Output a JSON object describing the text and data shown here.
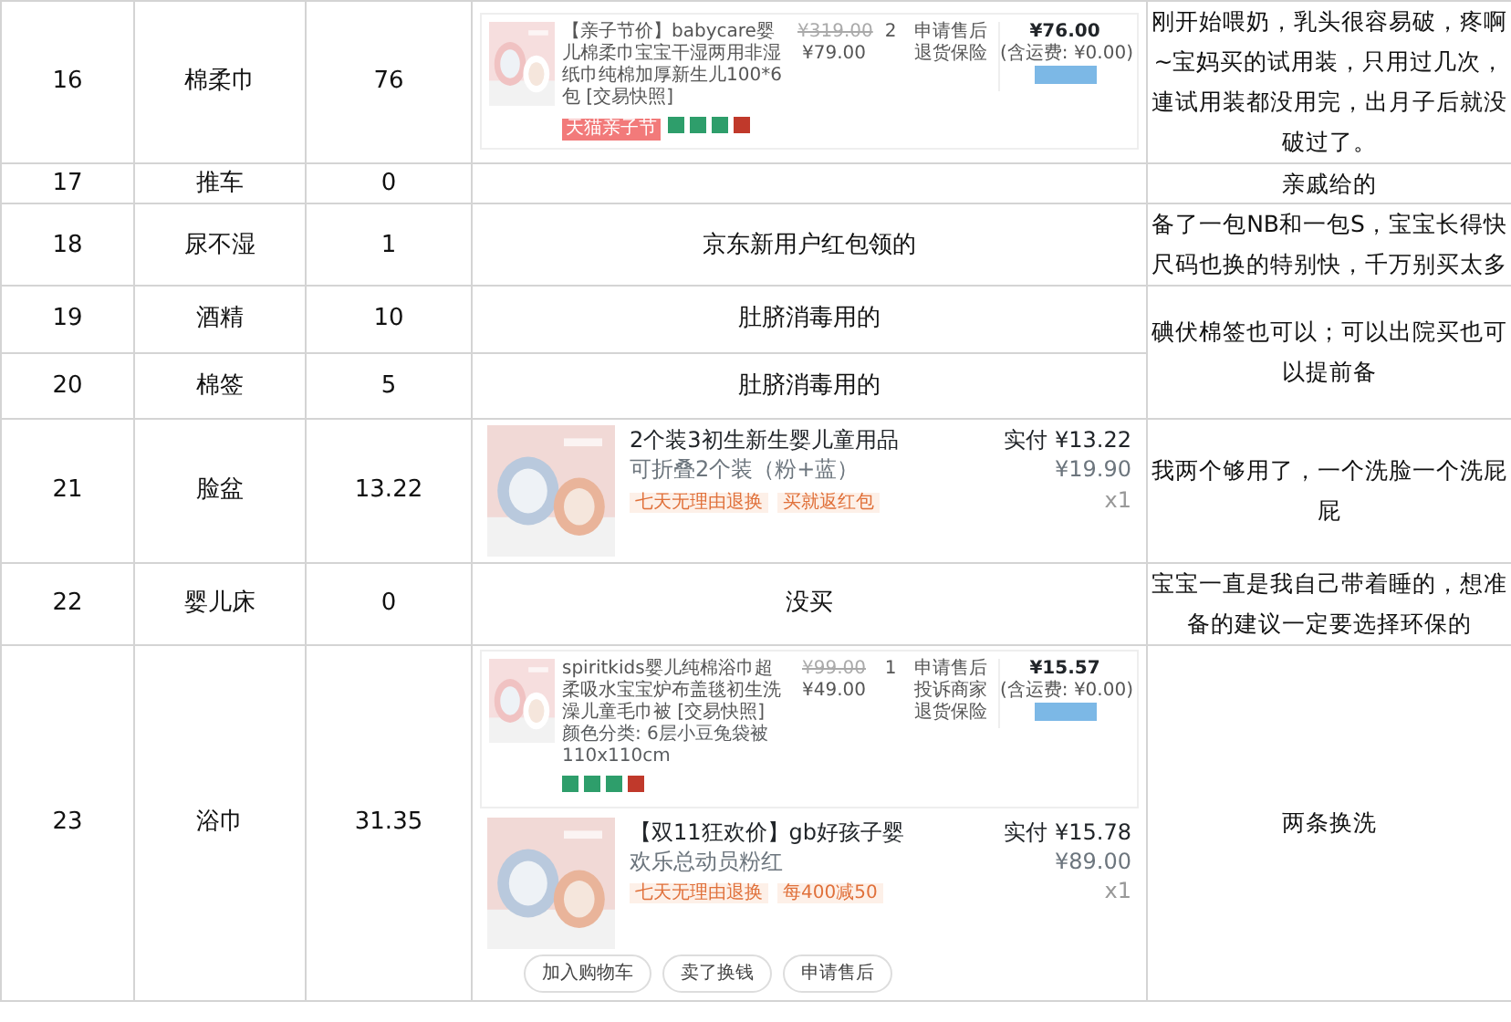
{
  "rows": [
    {
      "no": "16",
      "name": "棉柔巾",
      "amount": "76",
      "detail": {
        "kind": "orders",
        "orders": [
          {
            "kind": "desktop",
            "title": "【亲子节价】babycare婴儿棉柔巾宝宝干湿两用非湿纸巾纯棉加厚新生儿100*6包 [交易快照]",
            "tags": [
              "天猫亲子节"
            ],
            "service_icons": [
              {
                "color": "#2e9e6b"
              },
              {
                "color": "#2e9e6b"
              },
              {
                "color": "#2e9e6b"
              },
              {
                "color": "#c0392b"
              }
            ],
            "original_price": "¥319.00",
            "price": "¥79.00",
            "qty": "2",
            "actions": [
              "申请售后",
              "退货保险"
            ],
            "total": "¥76.00",
            "shipping": "(含运费: ¥0.00)"
          }
        ]
      },
      "note": "刚开始喂奶，乳头很容易破，疼啊~宝妈买的试用装，只用过几次，連试用装都没用完，出月子后就没破过了。"
    },
    {
      "no": "17",
      "name": "推车",
      "amount": "0",
      "detail": {
        "kind": "text"
      },
      "note": "亲戚给的"
    },
    {
      "no": "18",
      "name": "尿不湿",
      "amount": "1",
      "detail": {
        "kind": "text",
        "text": "京东新用户红包领的"
      },
      "note": "备了一包NB和一包S，宝宝长得快尺码也换的特别快，千万别买太多"
    },
    {
      "no": "19",
      "name": "酒精",
      "amount": "10",
      "detail": {
        "kind": "text",
        "text": "肚脐消毒用的"
      },
      "note": "碘伏棉签也可以；可以出院买也可以提前备",
      "note_shared_with_next": true
    },
    {
      "no": "20",
      "name": "棉签",
      "amount": "5",
      "detail": {
        "kind": "text",
        "text": "肚脐消毒用的"
      }
    },
    {
      "no": "21",
      "name": "脸盆",
      "amount": "13.22",
      "detail": {
        "kind": "orders",
        "orders": [
          {
            "kind": "mobile",
            "title": "2个装3初生新生婴儿童用品",
            "paid": "实付 ¥13.22",
            "spec": "可折叠2个装（粉+蓝）",
            "price": "¥19.90",
            "qty": "x1",
            "tags": [
              "七天无理由退换",
              "买就返红包"
            ]
          }
        ]
      },
      "note": "我两个够用了，一个洗脸一个洗屁屁"
    },
    {
      "no": "22",
      "name": "婴儿床",
      "amount": "0",
      "detail": {
        "kind": "text",
        "text": "没买"
      },
      "note": "宝宝一直是我自己带着睡的，想准备的建议一定要选择环保的"
    },
    {
      "no": "23",
      "name": "浴巾",
      "amount": "31.35",
      "detail": {
        "kind": "orders",
        "orders": [
          {
            "kind": "desktop",
            "title": "spiritkids婴儿纯棉浴巾超柔吸水宝宝炉布盖毯初生洗澡儿童毛巾被 [交易快照]",
            "spec": "颜色分类: 6层小豆兔袋被110x110cm",
            "service_icons": [
              {
                "color": "#2e9e6b"
              },
              {
                "color": "#2e9e6b"
              },
              {
                "color": "#2e9e6b"
              },
              {
                "color": "#c0392b"
              }
            ],
            "original_price": "¥99.00",
            "price": "¥49.00",
            "qty": "1",
            "actions": [
              "申请售后",
              "投诉商家",
              "退货保险"
            ],
            "total": "¥15.57",
            "shipping": "(含运费: ¥0.00)"
          },
          {
            "kind": "mobile",
            "title": "【双11狂欢价】gb好孩子婴",
            "paid": "实付 ¥15.78",
            "spec": "欢乐总动员粉红",
            "price": "¥89.00",
            "qty": "x1",
            "tags": [
              "七天无理由退换",
              "每400减50"
            ],
            "buttons": [
              "加入购物车",
              "卖了换钱",
              "申请售后"
            ]
          }
        ]
      },
      "note": "两条换洗"
    }
  ]
}
